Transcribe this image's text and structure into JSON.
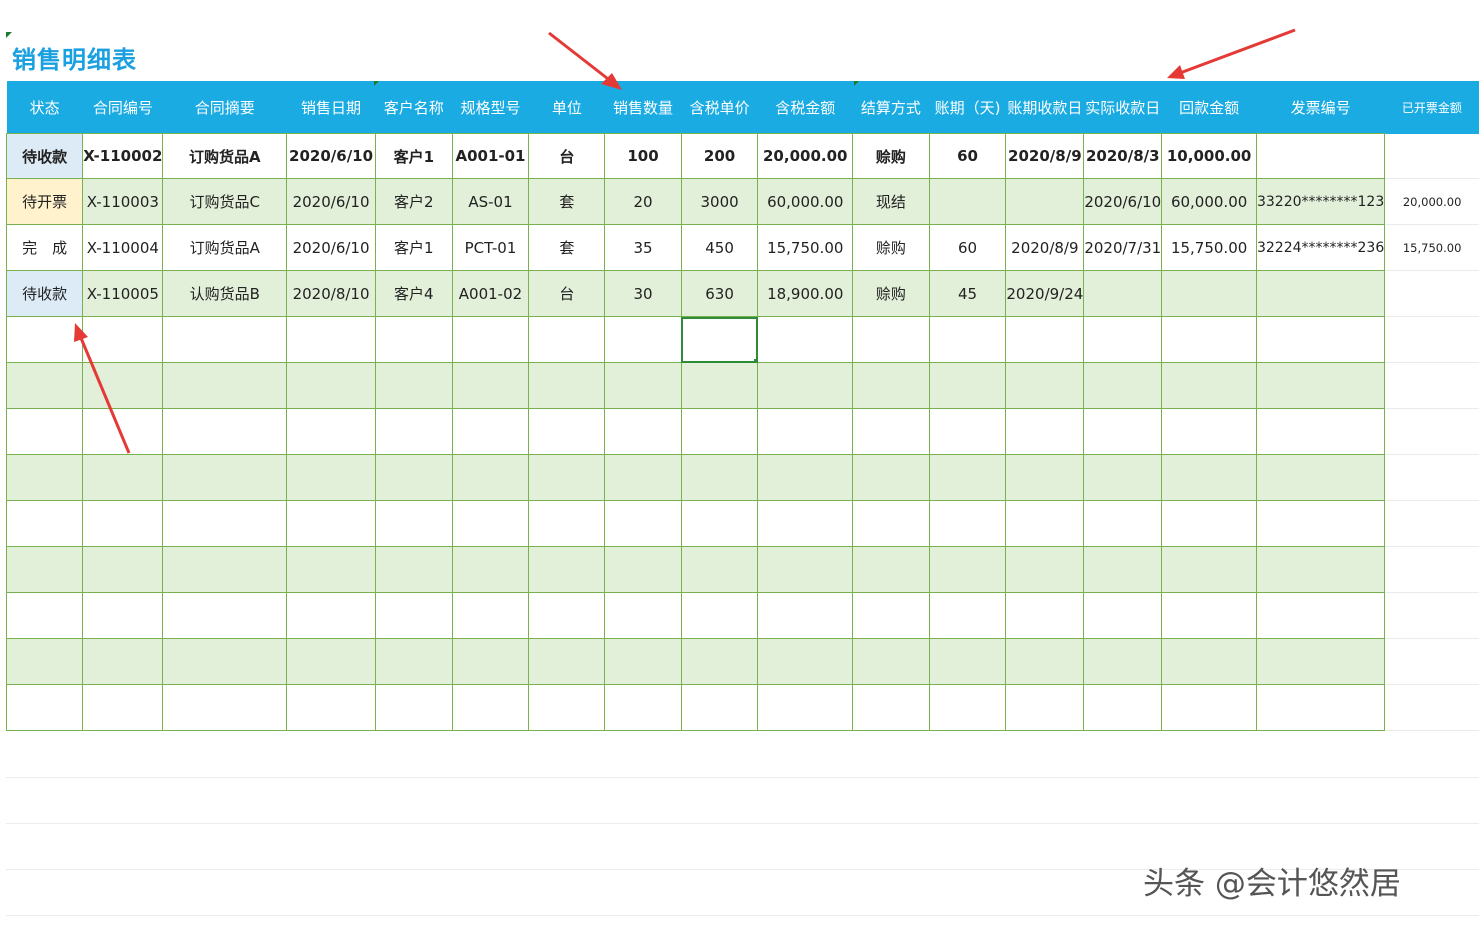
{
  "title": "销售明细表",
  "watermark": "头条 @会计悠然居",
  "headers": [
    "状态",
    "合同编号",
    "合同摘要",
    "销售日期",
    "客户名称",
    "规格型号",
    "单位",
    "销售数量",
    "含税单价",
    "含税金额",
    "结算方式",
    "账期（天)",
    "账期收款日",
    "实际收款日",
    "回款金额",
    "发票编号",
    "已开票金额"
  ],
  "rows": [
    [
      "待收款",
      "X-110002",
      "订购货品A",
      "2020/6/10",
      "客户1",
      "A001-01",
      "台",
      "100",
      "200",
      "20,000.00",
      "赊购",
      "60",
      "2020/8/9",
      "2020/8/3",
      "10,000.00",
      "",
      ""
    ],
    [
      "待开票",
      "X-110003",
      "订购货品C",
      "2020/6/10",
      "客户2",
      "AS-01",
      "套",
      "20",
      "3000",
      "60,000.00",
      "现结",
      "",
      "",
      "2020/6/10",
      "60,000.00",
      "33220********123",
      "20,000.00"
    ],
    [
      "完　成",
      "X-110004",
      "订购货品A",
      "2020/6/10",
      "客户1",
      "PCT-01",
      "套",
      "35",
      "450",
      "15,750.00",
      "赊购",
      "60",
      "2020/8/9",
      "2020/7/31",
      "15,750.00",
      "32224********236",
      "15,750.00"
    ],
    [
      "待收款",
      "X-110005",
      "认购货品B",
      "2020/8/10",
      "客户4",
      "A001-02",
      "台",
      "30",
      "630",
      "18,900.00",
      "赊购",
      "45",
      "2020/9/24",
      "",
      "",
      "",
      ""
    ]
  ],
  "colors": {
    "header_bg": "#1aabe3",
    "title": "#1aa0e0",
    "grid_line": "#78b24e",
    "band": "#e2efd9",
    "arrow": "#e53935"
  }
}
